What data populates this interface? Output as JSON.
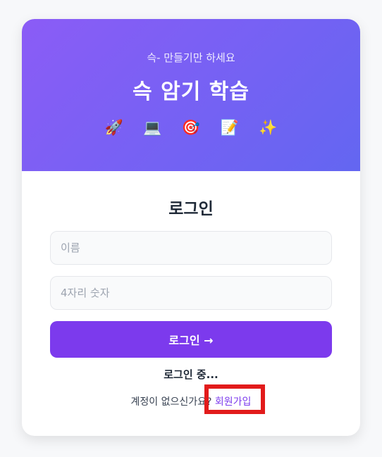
{
  "hero": {
    "subtitle": "슥- 만들기만 하세요",
    "title": "슥 암기 학습",
    "icons": [
      {
        "name": "rocket-icon",
        "glyph": "🚀"
      },
      {
        "name": "laptop-icon",
        "glyph": "💻"
      },
      {
        "name": "target-icon",
        "glyph": "🎯"
      },
      {
        "name": "notepad-icon",
        "glyph": "📝"
      },
      {
        "name": "sparkles-icon",
        "glyph": "✨"
      }
    ],
    "gradient": [
      "#8b5cf6",
      "#6366f1"
    ]
  },
  "form": {
    "heading": "로그인",
    "name_placeholder": "이름",
    "pin_placeholder": "4자리 숫자",
    "submit_label": "로그인 →",
    "status": "로그인 중...",
    "signup_prompt": "계정이 없으신가요? ",
    "signup_link": "회원가입"
  },
  "colors": {
    "accent": "#7c3aed",
    "highlight_box": "#e21b1b"
  }
}
